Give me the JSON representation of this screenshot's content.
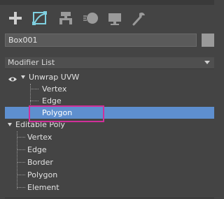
{
  "toolbar": {
    "icons": [
      "create-icon",
      "modify-icon",
      "hierarchy-icon",
      "motion-icon",
      "display-icon",
      "utilities-icon"
    ]
  },
  "object": {
    "name": "Box001"
  },
  "modifier_list": {
    "label": "Modifier List"
  },
  "stack": {
    "unwrap": {
      "label": "Unwrap UVW",
      "children": [
        "Vertex",
        "Edge",
        "Polygon"
      ]
    },
    "editable_poly": {
      "label": "Editable Poly",
      "children": [
        "Vertex",
        "Edge",
        "Border",
        "Polygon",
        "Element"
      ]
    }
  },
  "colors": {
    "selection": "#5e8fcf",
    "annotation": "#d0309a",
    "modify_icon": "#7fd0e0"
  }
}
